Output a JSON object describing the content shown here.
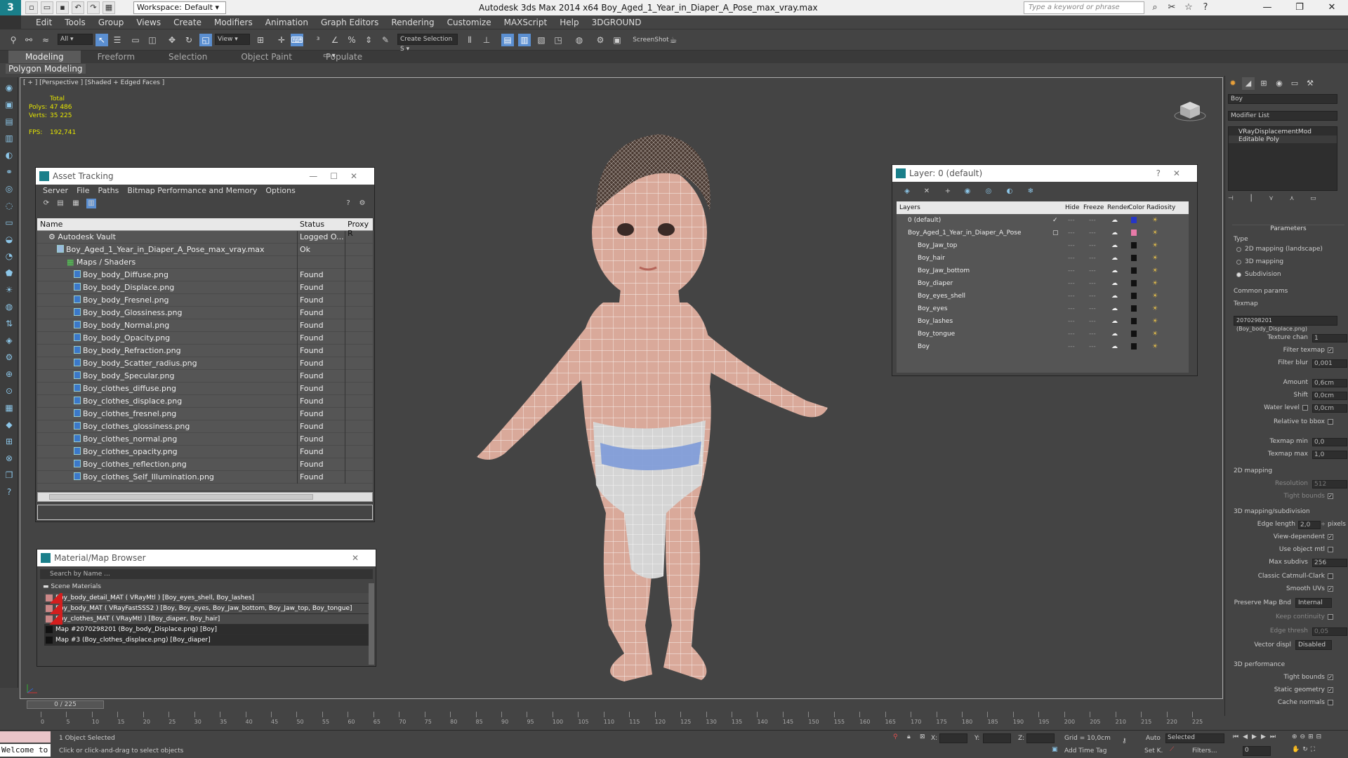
{
  "app": {
    "workspace_label": "Workspace:",
    "workspace_value": "Default",
    "window_title": "Autodesk 3ds Max  2014 x64      Boy_Aged_1_Year_in_Diaper_A_Pose_max_vray.max",
    "search_placeholder": "Type a keyword or phrase"
  },
  "menu": [
    "Edit",
    "Tools",
    "Group",
    "Views",
    "Create",
    "Modifiers",
    "Animation",
    "Graph Editors",
    "Rendering",
    "Customize",
    "MAXScript",
    "Help",
    "3DGROUND"
  ],
  "toolbar": {
    "filter_dropdown": "All",
    "coord_dropdown": "View",
    "selection_set": "Create Selection S",
    "screenshot_label": "ScreenShot"
  },
  "ribbon": {
    "tabs": [
      "Modeling",
      "Freeform",
      "Selection",
      "Object Paint",
      "Populate"
    ],
    "active_tab": "Modeling",
    "subtab": "Polygon Modeling"
  },
  "viewport": {
    "label": "[ + ] [Perspective ] [Shaded + Edged Faces ]",
    "stats_header": "Total",
    "polys_label": "Polys:",
    "polys_value": "47 486",
    "verts_label": "Verts:",
    "verts_value": "35 225",
    "fps_label": "FPS:",
    "fps_value": "192,741"
  },
  "asset_tracking": {
    "title": "Asset Tracking",
    "menu": [
      "Server",
      "File",
      "Paths",
      "Bitmap Performance and Memory",
      "Options"
    ],
    "columns": [
      "Name",
      "Status",
      "Proxy R"
    ],
    "rows": [
      {
        "name": "Autodesk Vault",
        "status": "Logged O..."
      },
      {
        "name": "Boy_Aged_1_Year_in_Diaper_A_Pose_max_vray.max",
        "status": "Ok"
      },
      {
        "name": "Maps / Shaders",
        "status": ""
      },
      {
        "name": "Boy_body_Diffuse.png",
        "status": "Found"
      },
      {
        "name": "Boy_body_Displace.png",
        "status": "Found"
      },
      {
        "name": "Boy_body_Fresnel.png",
        "status": "Found"
      },
      {
        "name": "Boy_body_Glossiness.png",
        "status": "Found"
      },
      {
        "name": "Boy_body_Normal.png",
        "status": "Found"
      },
      {
        "name": "Boy_body_Opacity.png",
        "status": "Found"
      },
      {
        "name": "Boy_body_Refraction.png",
        "status": "Found"
      },
      {
        "name": "Boy_body_Scatter_radius.png",
        "status": "Found"
      },
      {
        "name": "Boy_body_Specular.png",
        "status": "Found"
      },
      {
        "name": "Boy_clothes_diffuse.png",
        "status": "Found"
      },
      {
        "name": "Boy_clothes_displace.png",
        "status": "Found"
      },
      {
        "name": "Boy_clothes_fresnel.png",
        "status": "Found"
      },
      {
        "name": "Boy_clothes_glossiness.png",
        "status": "Found"
      },
      {
        "name": "Boy_clothes_normal.png",
        "status": "Found"
      },
      {
        "name": "Boy_clothes_opacity.png",
        "status": "Found"
      },
      {
        "name": "Boy_clothes_reflection.png",
        "status": "Found"
      },
      {
        "name": "Boy_clothes_Self_Illumination.png",
        "status": "Found"
      }
    ]
  },
  "layer_dialog": {
    "title": "Layer: 0 (default)",
    "columns": [
      "Layers",
      "Hide",
      "Freeze",
      "Render",
      "Color",
      "Radiosity"
    ],
    "rows": [
      {
        "name": "0 (default)",
        "color": "#2636c8"
      },
      {
        "name": "Boy_Aged_1_Year_in_Diaper_A_Pose",
        "color": "#e87aa8"
      },
      {
        "name": "Boy_Jaw_top",
        "color": "#111111"
      },
      {
        "name": "Boy_hair",
        "color": "#111111"
      },
      {
        "name": "Boy_Jaw_bottom",
        "color": "#111111"
      },
      {
        "name": "Boy_diaper",
        "color": "#111111"
      },
      {
        "name": "Boy_eyes_shell",
        "color": "#111111"
      },
      {
        "name": "Boy_eyes",
        "color": "#111111"
      },
      {
        "name": "Boy_lashes",
        "color": "#111111"
      },
      {
        "name": "Boy_tongue",
        "color": "#111111"
      },
      {
        "name": "Boy",
        "color": "#111111"
      }
    ],
    "dash": "---",
    "render_glyph": "☁",
    "radiosity_glyph": "☀"
  },
  "material_browser": {
    "title": "Material/Map Browser",
    "search_placeholder": "Search by Name ...",
    "section": "Scene Materials",
    "items": [
      "Boy_body_detail_MAT ( VRayMtl ) [Boy_eyes_shell, Boy_lashes]",
      "Boy_body_MAT ( VRayFastSSS2 ) [Boy, Boy_eyes, Boy_Jaw_bottom, Boy_Jaw_top, Boy_tongue]",
      "Boy_clothes_MAT ( VRayMtl ) [Boy_diaper, Boy_hair]",
      "Map #2070298201 (Boy_body_Displace.png) [Boy]",
      "Map #3 (Boy_clothes_displace.png) [Boy_diaper]"
    ]
  },
  "command_panel": {
    "object_name": "Boy",
    "modifier_list": "Modifier List",
    "stack": [
      "VRayDisplacementMod",
      "Editable Poly"
    ],
    "parameters": "Parameters",
    "type_label": "Type",
    "type_options": [
      "2D mapping (landscape)",
      "3D mapping",
      "Subdivision"
    ],
    "common_params": "Common params",
    "texmap_label": "Texmap",
    "texmap_value": "2070298201 (Boy_body_Displace.png)",
    "texture_chan_label": "Texture chan",
    "texture_chan_value": "1",
    "filter_texmap": "Filter texmap",
    "filter_blur_label": "Filter blur",
    "filter_blur_value": "0,001",
    "amount_label": "Amount",
    "amount_value": "0,6cm",
    "shift_label": "Shift",
    "shift_value": "0,0cm",
    "water_level_label": "Water level",
    "water_level_value": "0,0cm",
    "relative_to_bbox": "Relative to bbox",
    "texmap_min_label": "Texmap min",
    "texmap_min_value": "0,0",
    "texmap_max_label": "Texmap max",
    "texmap_max_value": "1,0",
    "mapping2d": "2D mapping",
    "resolution_label": "Resolution",
    "resolution_value": "512",
    "tight_bounds": "Tight bounds",
    "mapping3d": "3D mapping/subdivision",
    "edge_length_label": "Edge length",
    "edge_length_value": "2,0",
    "pixels": "pixels",
    "view_dependent": "View-dependent",
    "use_object_mtl": "Use object mtl",
    "max_subdivs_label": "Max subdivs",
    "max_subdivs_value": "256",
    "classic_catmull": "Classic Catmull-Clark",
    "smooth_uvs": "Smooth UVs",
    "preserve_map_bnd_label": "Preserve Map Bnd",
    "preserve_map_bnd_value": "Internal",
    "keep_continuity": "Keep continuity",
    "edge_thresh_label": "Edge thresh",
    "edge_thresh_value": "0,05",
    "vector_displ_label": "Vector displ",
    "vector_displ_value": "Disabled",
    "perf": "3D performance",
    "tight_bounds2": "Tight bounds",
    "static_geometry": "Static geometry",
    "cache_normals": "Cache normals"
  },
  "timeline": {
    "frame": "0 / 225",
    "ticks": [
      "0",
      "5",
      "10",
      "15",
      "20",
      "25",
      "30",
      "35",
      "40",
      "45",
      "50",
      "55",
      "60",
      "65",
      "70",
      "75",
      "80",
      "85",
      "90",
      "95",
      "100",
      "105",
      "110",
      "115",
      "120",
      "125",
      "130",
      "135",
      "140",
      "145",
      "150",
      "155",
      "160",
      "165",
      "170",
      "175",
      "180",
      "185",
      "190",
      "195",
      "200",
      "205",
      "210",
      "215",
      "220",
      "225"
    ]
  },
  "status": {
    "selected": "1 Object Selected",
    "prompt": "Click or click-and-drag to select objects",
    "welcome": "Welcome to",
    "x_label": "X:",
    "y_label": "Y:",
    "z_label": "Z:",
    "grid": "Grid = 10,0cm",
    "add_time_tag": "Add Time Tag",
    "auto": "Auto",
    "selected_dd": "Selected",
    "setk": "Set K.",
    "filters": "Filters...",
    "frame_field": "0"
  }
}
